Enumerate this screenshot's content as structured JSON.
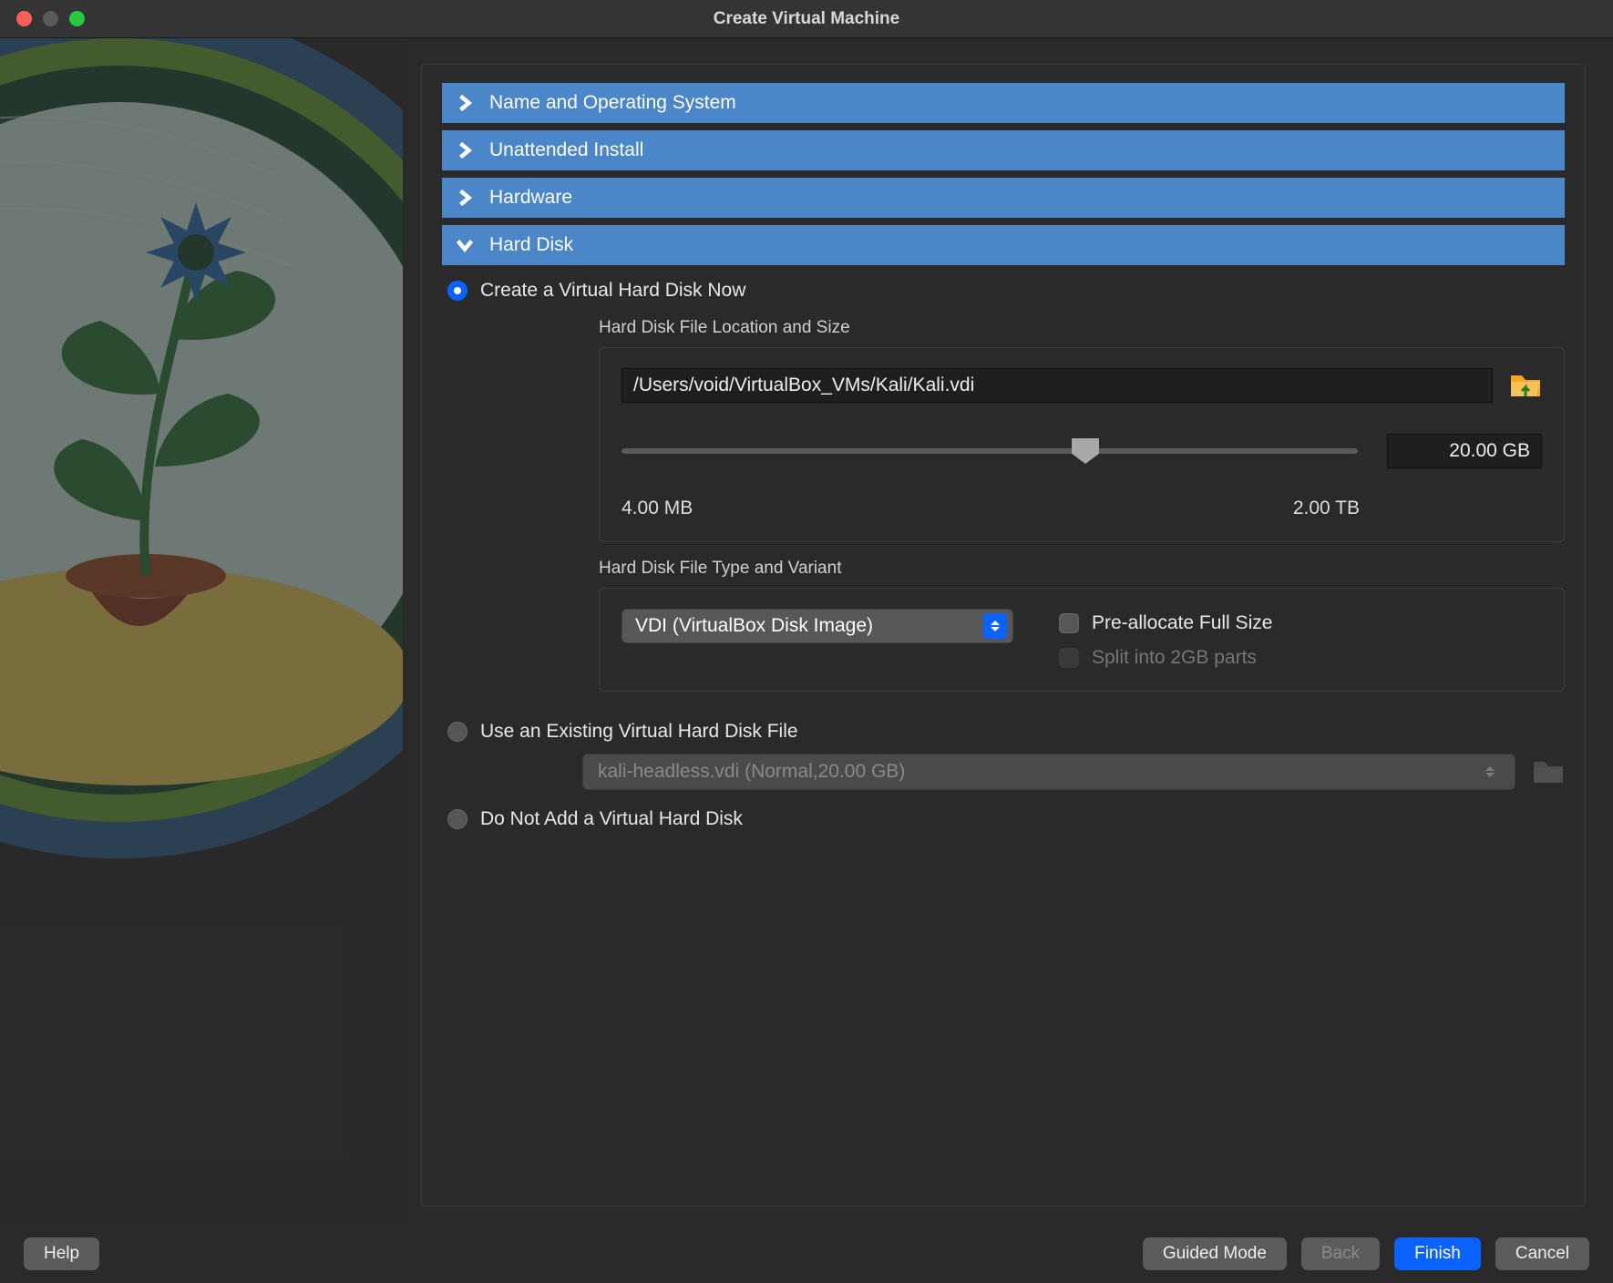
{
  "window": {
    "title": "Create Virtual Machine"
  },
  "sections": {
    "name_os": "Name and Operating System",
    "unattended": "Unattended Install",
    "hardware": "Hardware",
    "hard_disk": "Hard Disk"
  },
  "hard_disk": {
    "create_now_label": "Create a Virtual Hard Disk Now",
    "use_existing_label": "Use an Existing Virtual Hard Disk File",
    "do_not_add_label": "Do Not Add a Virtual Hard Disk",
    "location_size_title": "Hard Disk File Location and Size",
    "path_value": "/Users/void/VirtualBox_VMs/Kali/Kali.vdi",
    "size_value": "20.00 GB",
    "slider_min_label": "4.00 MB",
    "slider_max_label": "2.00 TB",
    "type_variant_title": "Hard Disk File Type and Variant",
    "type_value": "VDI (VirtualBox Disk Image)",
    "preallocate_label": "Pre-allocate Full Size",
    "split_label": "Split into 2GB parts",
    "existing_file_value": "kali-headless.vdi (Normal,20.00 GB)"
  },
  "buttons": {
    "help": "Help",
    "guided": "Guided Mode",
    "back": "Back",
    "finish": "Finish",
    "cancel": "Cancel"
  },
  "colors": {
    "accent": "#0a63ff",
    "bar": "#4a86c8"
  }
}
